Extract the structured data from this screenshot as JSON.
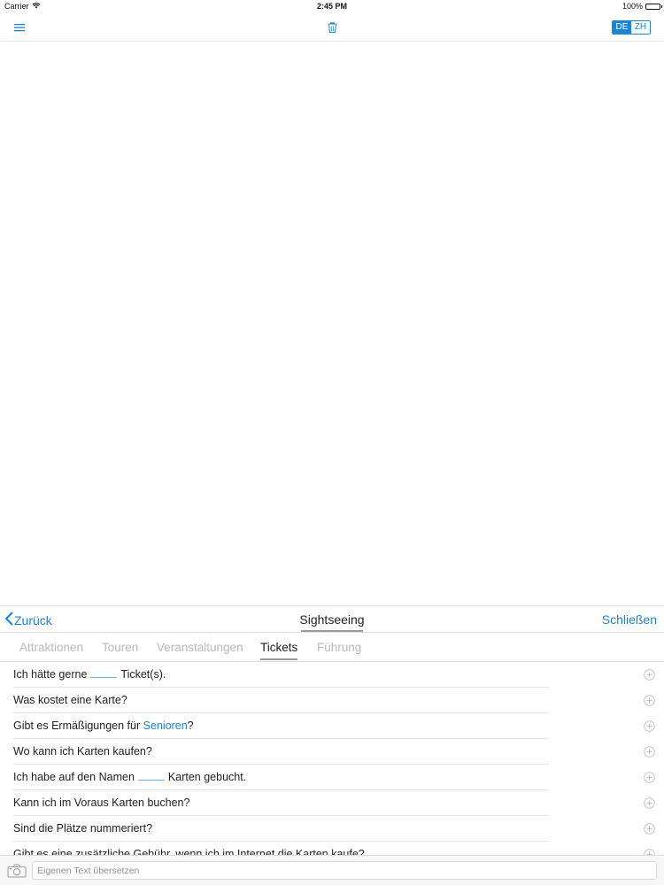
{
  "status_bar": {
    "carrier": "Carrier",
    "time": "2:45 PM",
    "battery": "100%",
    "battery_level": 1.0
  },
  "toolbar": {
    "menu_icon": "hamburger-menu-icon",
    "trash_icon": "trash-icon",
    "languages": [
      {
        "label": "DE",
        "selected": true
      },
      {
        "label": "ZH",
        "selected": false
      }
    ]
  },
  "phrase_panel": {
    "back_label": "Zurück",
    "title": "Sightseeing",
    "close_label": "Schließen",
    "tabs": [
      {
        "label": "Attraktionen",
        "active": false
      },
      {
        "label": "Touren",
        "active": false
      },
      {
        "label": "Veranstaltungen",
        "active": false
      },
      {
        "label": "Tickets",
        "active": true
      },
      {
        "label": "Führung",
        "active": false
      }
    ],
    "phrases": [
      {
        "before": "Ich hätte gerne",
        "blank": true,
        "after": "Ticket(s)."
      },
      {
        "text": "Was kostet eine Karte?"
      },
      {
        "before": "Gibt es Ermäßigungen für ",
        "highlight": "Senioren",
        "after": "?"
      },
      {
        "text": "Wo kann ich Karten kaufen?"
      },
      {
        "before": "Ich habe auf den Namen",
        "blank": true,
        "after": "Karten gebucht."
      },
      {
        "text": "Kann ich im Voraus Karten buchen?"
      },
      {
        "text": "Sind die Plätze nummeriert?"
      },
      {
        "text": "Gibt es eine zusätzliche Gebühr, wenn ich im Internet die Karten kaufe?"
      }
    ]
  },
  "bottom_bar": {
    "camera_icon": "camera-icon",
    "input_placeholder": "Eigenen Text übersetzen",
    "input_value": ""
  },
  "colors": {
    "accent": "#1a84d6",
    "inactive_tab": "#b9b9b9",
    "separator": "#e6e6e6"
  }
}
